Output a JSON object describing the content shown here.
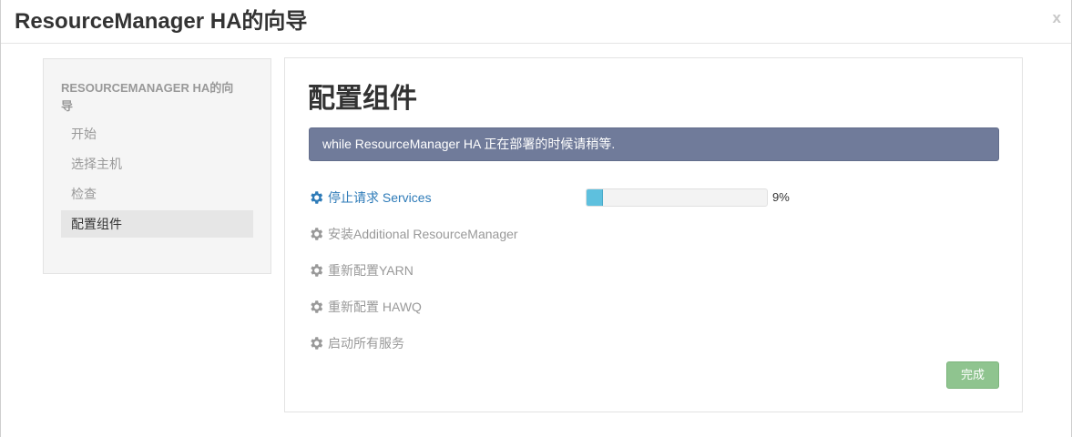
{
  "modal": {
    "title": "ResourceManager HA的向导",
    "close_label": "x"
  },
  "sidebar": {
    "header": "RESOURCEMANAGER HA的向导",
    "items": [
      {
        "label": "开始",
        "active": false
      },
      {
        "label": "选择主机",
        "active": false
      },
      {
        "label": "检查",
        "active": false
      },
      {
        "label": "配置组件",
        "active": true
      }
    ]
  },
  "main": {
    "title": "配置组件",
    "alert": "while ResourceManager HA 正在部署的时候请稍等.",
    "tasks": [
      {
        "label": "停止请求 Services",
        "status": "in-progress",
        "icon": "gear-icon"
      },
      {
        "label": "安装Additional ResourceManager",
        "status": "pending",
        "icon": "gear-icon"
      },
      {
        "label": "重新配置YARN",
        "status": "pending",
        "icon": "gear-icon"
      },
      {
        "label": "重新配置 HAWQ",
        "status": "pending",
        "icon": "gear-icon"
      },
      {
        "label": "启动所有服务",
        "status": "pending",
        "icon": "gear-icon"
      }
    ],
    "progress": {
      "value": 9,
      "label": "9%"
    },
    "done_button": "完成"
  },
  "colors": {
    "alert_bg": "#707b9a",
    "link": "#2e7bb8",
    "progress_fill": "#5ec0de",
    "done_button": "#8fc48f"
  }
}
